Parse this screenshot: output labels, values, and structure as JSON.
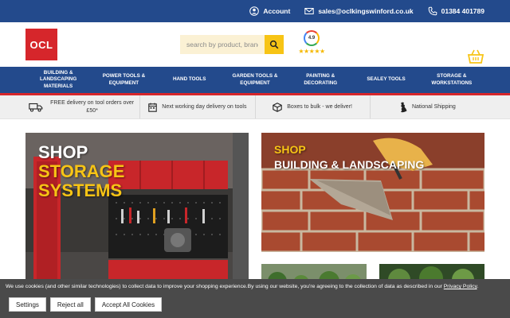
{
  "topbar": {
    "account_label": "Account",
    "email": "sales@oclkingswinford.co.uk",
    "phone": "01384 401789"
  },
  "header": {
    "logo_text": "OCL",
    "search_placeholder": "search by product, brand",
    "rating_value": "4.9",
    "rating_stars": "★★★★★"
  },
  "nav": {
    "items": [
      "Building & Landscaping Materials",
      "Power Tools & Equipment",
      "Hand Tools",
      "Garden Tools & Equipment",
      "Painting & Decorating",
      "Sealey Tools",
      "Storage & Workstations"
    ]
  },
  "usp": {
    "items": [
      "FREE delivery on tool orders over £50*",
      "Next working day delivery on tools",
      "Boxes to bulk - we deliver!",
      "National Shipping"
    ]
  },
  "promos": {
    "storage": {
      "line1": "Shop",
      "line2": "Storage",
      "line3": "Systems"
    },
    "building": {
      "line1": "Shop",
      "line2": "Building & Landscaping"
    }
  },
  "cookie": {
    "message": "We use cookies (and other similar technologies) to collect data to improve your shopping experience.By using our website, you're agreeing to the collection of data as described in our ",
    "policy_link": "Privacy Policy",
    "period": ".",
    "settings_label": "Settings",
    "reject_label": "Reject all",
    "accept_label": "Accept All Cookies"
  },
  "colors": {
    "brand_blue": "#234a8c",
    "brand_red": "#d6262b",
    "brand_yellow": "#f7c415"
  }
}
